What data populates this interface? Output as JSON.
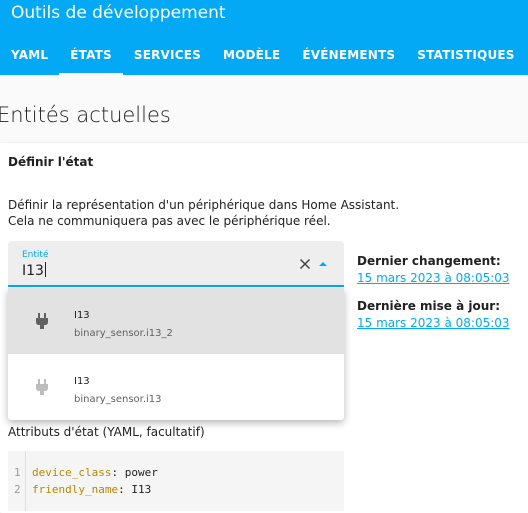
{
  "header": {
    "title": "Outils de développement",
    "tabs": [
      {
        "label": "YAML"
      },
      {
        "label": "ÉTATS"
      },
      {
        "label": "SERVICES"
      },
      {
        "label": "MODÈLE"
      },
      {
        "label": "ÉVÉNEMENTS"
      },
      {
        "label": "STATISTIQUES"
      }
    ],
    "active_tab": "ÉTATS"
  },
  "page": {
    "heading": "Entités actuelles"
  },
  "set_state": {
    "title": "Définir l'état",
    "description_line1": "Définir la représentation d'un périphérique dans Home Assistant.",
    "description_line2": "Cela ne communiquera pas avec le périphérique réel.",
    "entity_field": {
      "label": "Entité",
      "value": "I13"
    },
    "options": [
      {
        "name": "I13",
        "entity_id": "binary_sensor.i13_2",
        "icon": "power-plug-icon"
      },
      {
        "name": "I13",
        "entity_id": "binary_sensor.i13",
        "icon": "power-plug-icon"
      }
    ],
    "last_changed_label": "Dernier changement:",
    "last_changed_value": "15 mars 2023 à 08:05:03",
    "last_updated_label": "Dernière mise à jour:",
    "last_updated_value": "15 mars 2023 à 08:05:03",
    "attributes_label": "Attributs d'état (YAML, facultatif)",
    "code_lines": [
      {
        "num": "1",
        "key": "device_class",
        "value": "power"
      },
      {
        "num": "2",
        "key": "friendly_name",
        "value": "I13"
      }
    ]
  },
  "colors": {
    "primary": "#03a9f4",
    "highlight": "#e2e2e2"
  }
}
